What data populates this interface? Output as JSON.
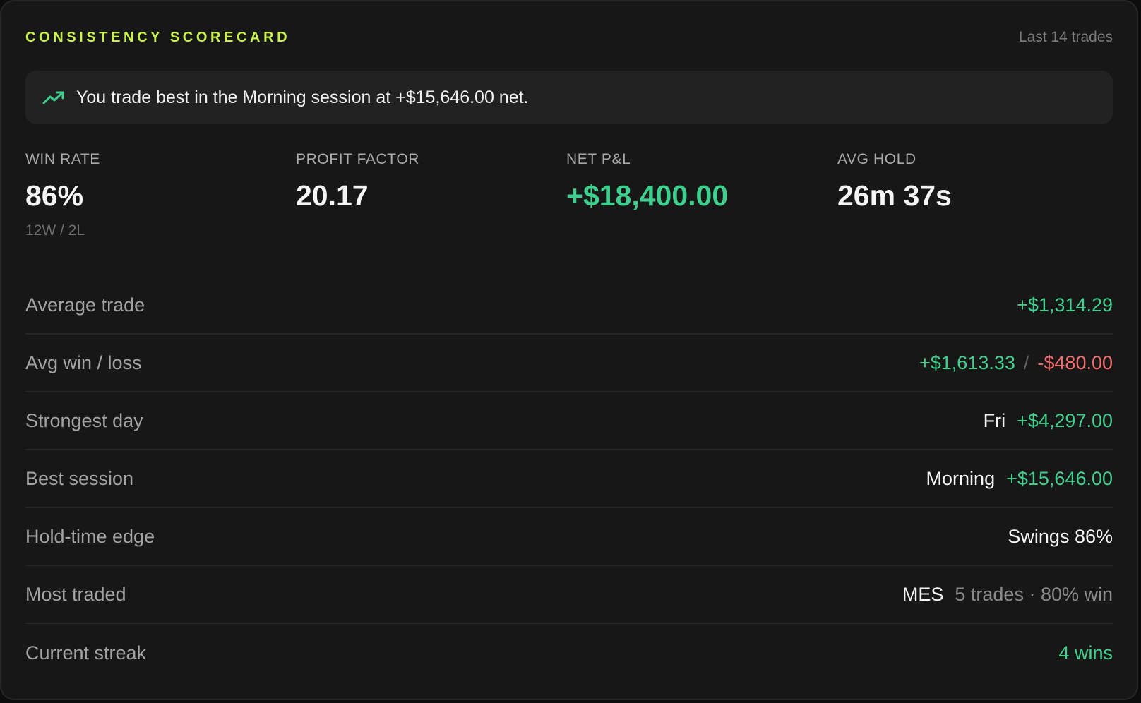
{
  "header": {
    "title": "CONSISTENCY SCORECARD",
    "meta": "Last 14 trades"
  },
  "insight": {
    "icon": "trending-up-icon",
    "text": "You trade best in the Morning session at +$15,646.00 net."
  },
  "stats": [
    {
      "label": "WIN RATE",
      "value": "86%",
      "sub": "12W / 2L"
    },
    {
      "label": "PROFIT FACTOR",
      "value": "20.17"
    },
    {
      "label": "NET P&L",
      "value": "+$18,400.00"
    },
    {
      "label": "AVG HOLD",
      "value": "26m 37s"
    }
  ],
  "rows": {
    "average_trade": {
      "label": "Average trade",
      "value": "+$1,314.29"
    },
    "avg_win_loss": {
      "label": "Avg win / loss",
      "win": "+$1,613.33",
      "separator": "/",
      "loss": "-$480.00"
    },
    "strongest_day": {
      "label": "Strongest day",
      "day": "Fri",
      "value": "+$4,297.00"
    },
    "best_session": {
      "label": "Best session",
      "session": "Morning",
      "value": "+$15,646.00"
    },
    "hold_time_edge": {
      "label": "Hold-time edge",
      "value": "Swings 86%"
    },
    "most_traded": {
      "label": "Most traded",
      "symbol": "MES",
      "detail": "5 trades · 80% win"
    },
    "current_streak": {
      "label": "Current streak",
      "value": "4 wins"
    }
  },
  "colors": {
    "accent": "#c8f24a",
    "positive": "#3fcf8e",
    "negative": "#f26d6d",
    "card_bg": "#171717"
  }
}
